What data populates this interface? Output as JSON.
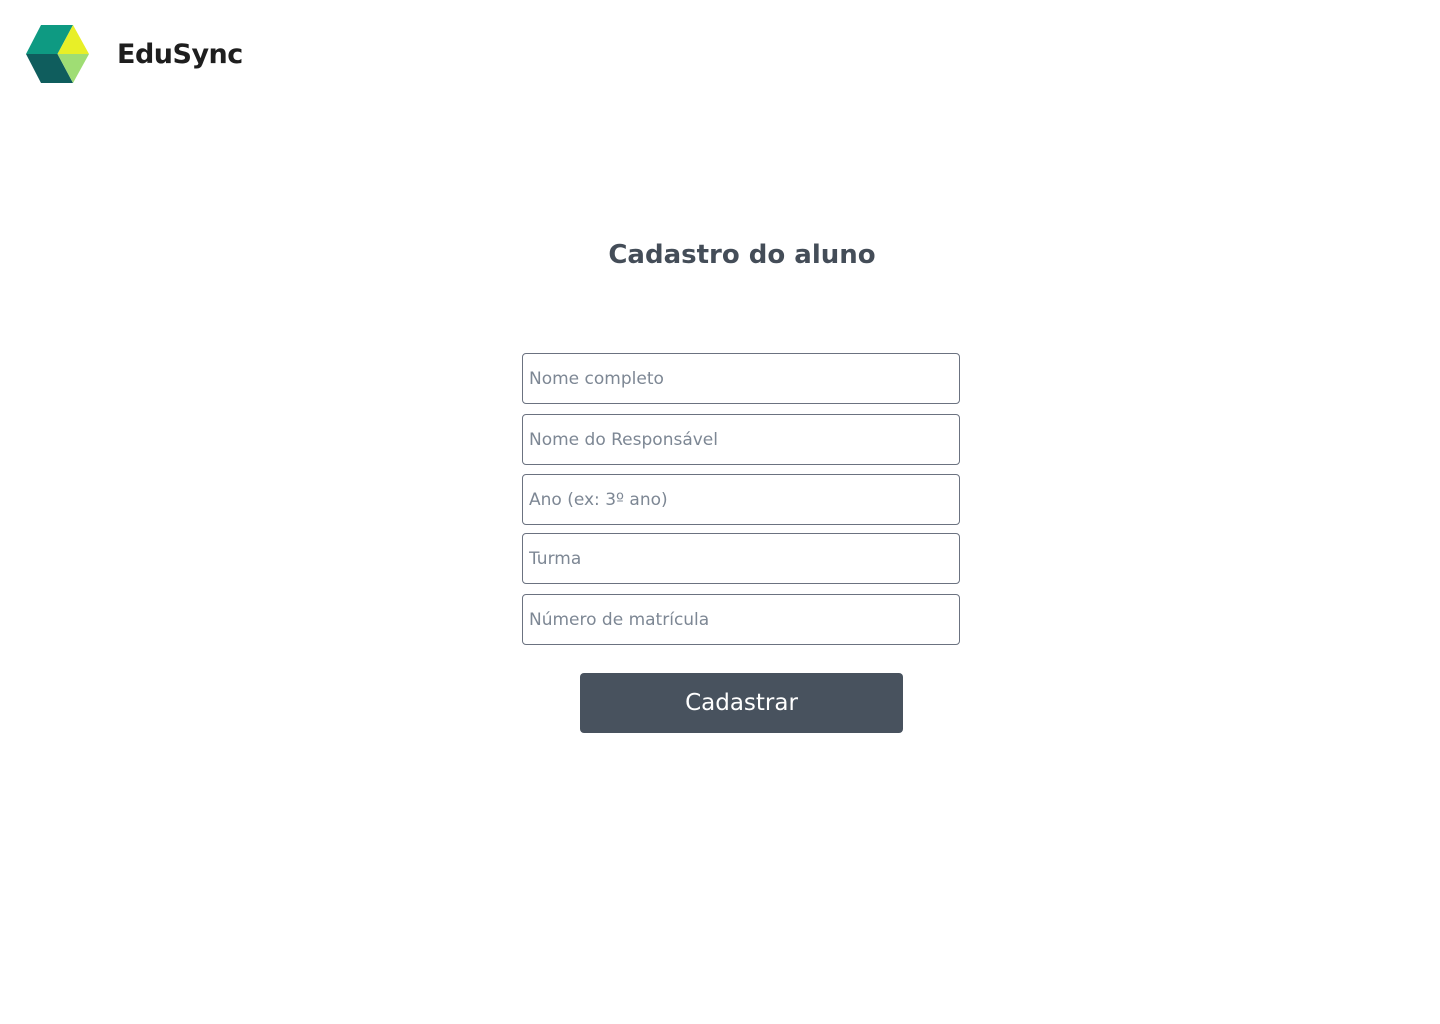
{
  "brand": {
    "name": "EduSync",
    "logo_icon": "hexagon-cube-icon",
    "colors": [
      "#0e9a82",
      "#e8ef27",
      "#0f5d5d",
      "#9fdd74"
    ]
  },
  "page": {
    "title": "Cadastro do aluno"
  },
  "form": {
    "fields": [
      {
        "placeholder": "Nome completo",
        "value": ""
      },
      {
        "placeholder": "Nome do Responsável",
        "value": ""
      },
      {
        "placeholder": "Ano (ex: 3º ano)",
        "value": ""
      },
      {
        "placeholder": "Turma",
        "value": ""
      },
      {
        "placeholder": "Número de matrícula",
        "value": ""
      }
    ],
    "submit_label": "Cadastrar"
  },
  "colors": {
    "title": "#444d58",
    "button_bg": "#48525e",
    "field_border": "#6b7280",
    "placeholder": "#7d8794"
  }
}
